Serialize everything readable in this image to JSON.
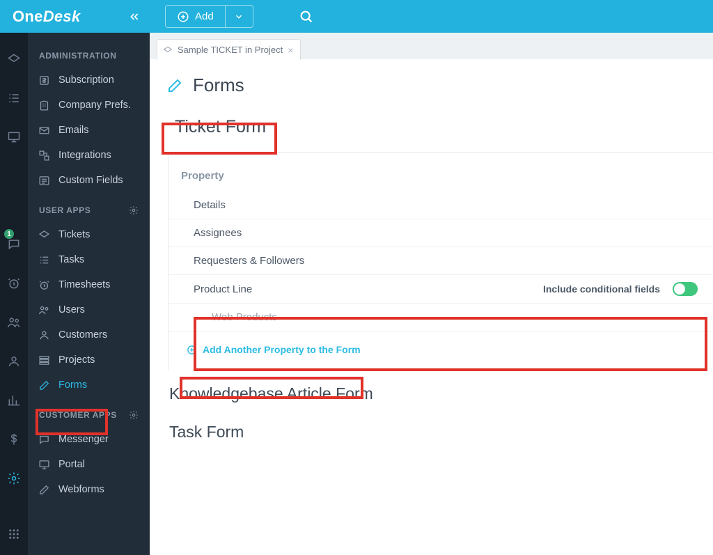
{
  "brand_first": "One",
  "brand_second": "Desk",
  "topbar": {
    "add_label": "Add"
  },
  "rail_badge": "1",
  "sidebar": {
    "sections": {
      "admin_label": "ADMINISTRATION",
      "user_apps_label": "USER APPS",
      "customer_apps_label": "CUSTOMER APPS"
    },
    "admin": [
      "Subscription",
      "Company Prefs.",
      "Emails",
      "Integrations",
      "Custom Fields"
    ],
    "user_apps": [
      "Tickets",
      "Tasks",
      "Timesheets",
      "Users",
      "Customers",
      "Projects",
      "Forms"
    ],
    "customer_apps": [
      "Messenger",
      "Portal",
      "Webforms"
    ]
  },
  "tab": {
    "label": "Sample TICKET in Project"
  },
  "page": {
    "title": "Forms",
    "ticket_form_label": "Ticket Form",
    "property_header": "Property",
    "rows": {
      "details": "Details",
      "assignees": "Assignees",
      "requesters": "Requesters & Followers",
      "product_line": "Product Line",
      "include_conditional": "Include conditional fields",
      "web_products": "Web Products"
    },
    "add_property_label": "Add Another Property to the Form",
    "kb_form_label": "Knowledgebase Article Form",
    "task_form_label": "Task Form"
  }
}
